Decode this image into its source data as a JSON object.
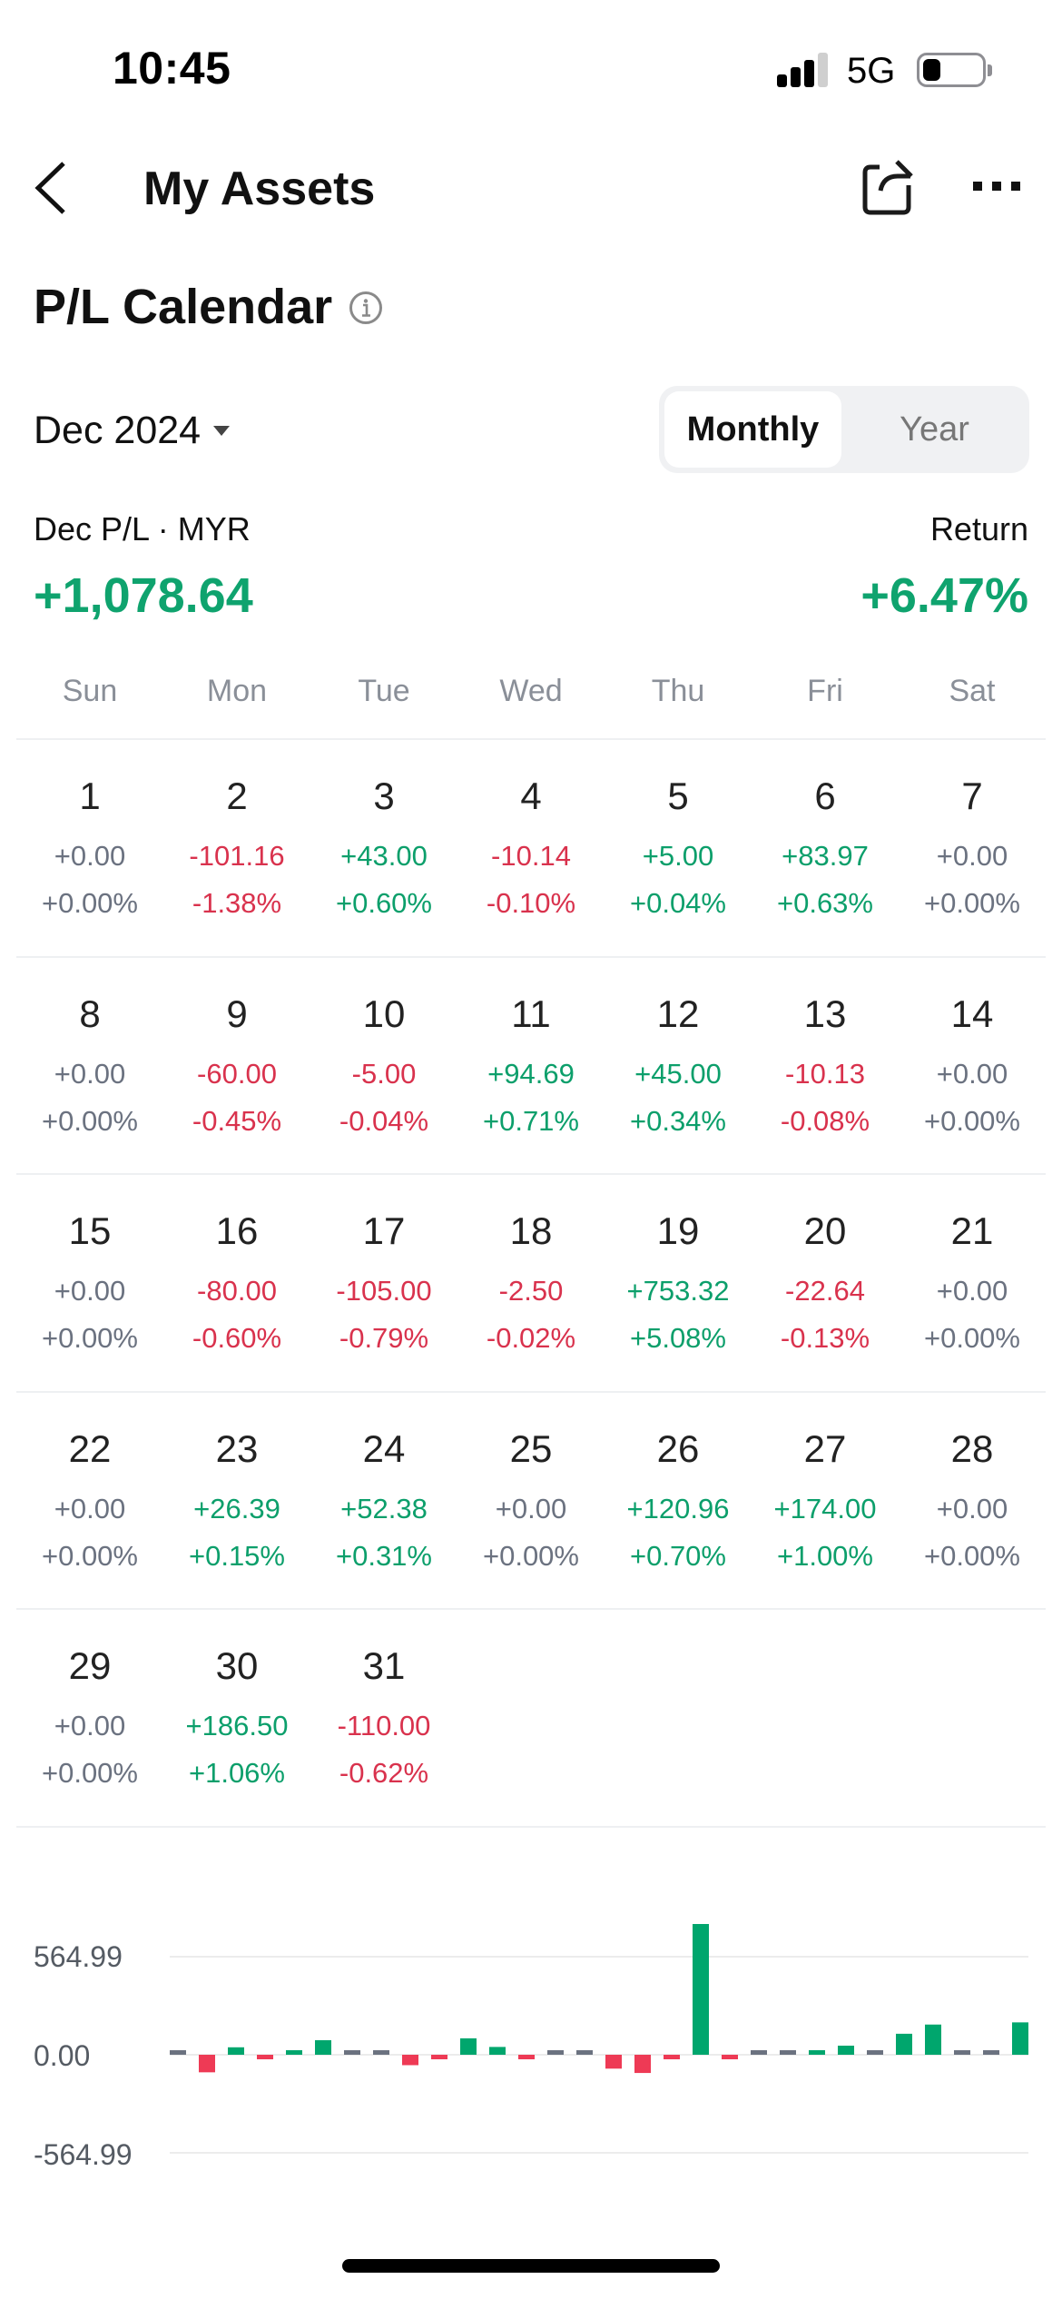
{
  "status_bar": {
    "time": "10:45",
    "network": "5G",
    "signal_bars_active": 3,
    "signal_bars_total": 4,
    "battery_level": 0.3
  },
  "header": {
    "title": "My Assets",
    "back_icon": "chevron-left-icon",
    "share_icon": "share-icon",
    "more_icon": "more-horizontal-icon"
  },
  "section": {
    "title": "P/L Calendar",
    "info_icon": "info-circle-icon"
  },
  "controls": {
    "month_selected": "Dec 2024",
    "view_toggle": [
      {
        "label": "Monthly",
        "active": true
      },
      {
        "label": "Year",
        "active": false
      }
    ]
  },
  "summary": {
    "pl_label": "Dec P/L · MYR",
    "pl_value": "+1,078.64",
    "return_label": "Return",
    "return_value": "+6.47%"
  },
  "colors": {
    "positive": "#0c9f6b",
    "negative": "#d9324d",
    "neutral": "#6b7280",
    "bar_positive": "#00a66d",
    "bar_negative": "#ee3a55",
    "bar_neutral": "#6b7280"
  },
  "calendar": {
    "weekdays": [
      "Sun",
      "Mon",
      "Tue",
      "Wed",
      "Thu",
      "Fri",
      "Sat"
    ],
    "weeks": [
      [
        {
          "day": "1",
          "value": "+0.00",
          "pct": "+0.00%",
          "sign": "zero"
        },
        {
          "day": "2",
          "value": "-101.16",
          "pct": "-1.38%",
          "sign": "neg"
        },
        {
          "day": "3",
          "value": "+43.00",
          "pct": "+0.60%",
          "sign": "pos"
        },
        {
          "day": "4",
          "value": "-10.14",
          "pct": "-0.10%",
          "sign": "neg"
        },
        {
          "day": "5",
          "value": "+5.00",
          "pct": "+0.04%",
          "sign": "pos"
        },
        {
          "day": "6",
          "value": "+83.97",
          "pct": "+0.63%",
          "sign": "pos"
        },
        {
          "day": "7",
          "value": "+0.00",
          "pct": "+0.00%",
          "sign": "zero"
        }
      ],
      [
        {
          "day": "8",
          "value": "+0.00",
          "pct": "+0.00%",
          "sign": "zero"
        },
        {
          "day": "9",
          "value": "-60.00",
          "pct": "-0.45%",
          "sign": "neg"
        },
        {
          "day": "10",
          "value": "-5.00",
          "pct": "-0.04%",
          "sign": "neg"
        },
        {
          "day": "11",
          "value": "+94.69",
          "pct": "+0.71%",
          "sign": "pos"
        },
        {
          "day": "12",
          "value": "+45.00",
          "pct": "+0.34%",
          "sign": "pos"
        },
        {
          "day": "13",
          "value": "-10.13",
          "pct": "-0.08%",
          "sign": "neg"
        },
        {
          "day": "14",
          "value": "+0.00",
          "pct": "+0.00%",
          "sign": "zero"
        }
      ],
      [
        {
          "day": "15",
          "value": "+0.00",
          "pct": "+0.00%",
          "sign": "zero"
        },
        {
          "day": "16",
          "value": "-80.00",
          "pct": "-0.60%",
          "sign": "neg"
        },
        {
          "day": "17",
          "value": "-105.00",
          "pct": "-0.79%",
          "sign": "neg"
        },
        {
          "day": "18",
          "value": "-2.50",
          "pct": "-0.02%",
          "sign": "neg"
        },
        {
          "day": "19",
          "value": "+753.32",
          "pct": "+5.08%",
          "sign": "pos"
        },
        {
          "day": "20",
          "value": "-22.64",
          "pct": "-0.13%",
          "sign": "neg"
        },
        {
          "day": "21",
          "value": "+0.00",
          "pct": "+0.00%",
          "sign": "zero"
        }
      ],
      [
        {
          "day": "22",
          "value": "+0.00",
          "pct": "+0.00%",
          "sign": "zero"
        },
        {
          "day": "23",
          "value": "+26.39",
          "pct": "+0.15%",
          "sign": "pos"
        },
        {
          "day": "24",
          "value": "+52.38",
          "pct": "+0.31%",
          "sign": "pos"
        },
        {
          "day": "25",
          "value": "+0.00",
          "pct": "+0.00%",
          "sign": "zero"
        },
        {
          "day": "26",
          "value": "+120.96",
          "pct": "+0.70%",
          "sign": "pos"
        },
        {
          "day": "27",
          "value": "+174.00",
          "pct": "+1.00%",
          "sign": "pos"
        },
        {
          "day": "28",
          "value": "+0.00",
          "pct": "+0.00%",
          "sign": "zero"
        }
      ],
      [
        {
          "day": "29",
          "value": "+0.00",
          "pct": "+0.00%",
          "sign": "zero"
        },
        {
          "day": "30",
          "value": "+186.50",
          "pct": "+1.06%",
          "sign": "pos"
        },
        {
          "day": "31",
          "value": "-110.00",
          "pct": "-0.62%",
          "sign": "neg"
        }
      ]
    ]
  },
  "chart_data": {
    "type": "bar",
    "title": "",
    "xlabel": "",
    "ylabel": "",
    "categories": [
      "1",
      "2",
      "3",
      "4",
      "5",
      "6",
      "7",
      "8",
      "9",
      "10",
      "11",
      "12",
      "13",
      "14",
      "15",
      "16",
      "17",
      "18",
      "19",
      "20",
      "21",
      "22",
      "23",
      "24",
      "25",
      "26",
      "27",
      "28",
      "29",
      "30"
    ],
    "values": [
      0,
      -101.16,
      43.0,
      -10.14,
      5.0,
      83.97,
      0,
      0,
      -60.0,
      -5.0,
      94.69,
      45.0,
      -10.13,
      0,
      0,
      -80.0,
      -105.0,
      -2.5,
      753.32,
      -22.64,
      0,
      0,
      26.39,
      52.38,
      0,
      120.96,
      174.0,
      0,
      0,
      186.5
    ],
    "yticks": [
      564.99,
      0,
      -564.99
    ],
    "ytick_labels": [
      "564.99",
      "0.00",
      "-564.99"
    ],
    "ylim": [
      -564.99,
      564.99
    ],
    "grid": true,
    "legend": "none"
  }
}
